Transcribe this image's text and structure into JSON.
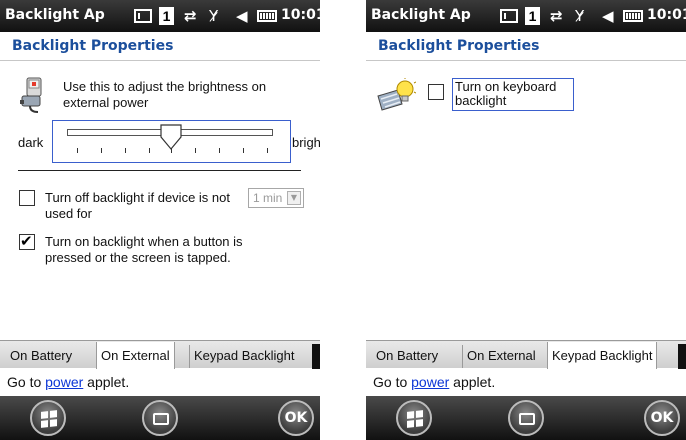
{
  "status_bar": {
    "title": "Backlight Ap",
    "sim_icon": "sim-card-icon",
    "sim_slot": "1",
    "connectivity_icon": "data-connection-icon",
    "signal_icon": "no-signal-icon",
    "volume_icon": "volume-icon",
    "battery_icon": "battery-icon",
    "clock": "10:01"
  },
  "page_title": "Backlight Properties",
  "external_tab_view": {
    "description": "Use this to adjust the brightness on external power",
    "slider": {
      "min_label": "dark",
      "max_label": "bright",
      "level": 0.5
    },
    "option_auto_off": {
      "label": "Turn off backlight if device is not used for",
      "checked": false,
      "timeout_value": "1 min"
    },
    "option_tap_on": {
      "label": "Turn on backlight when a button is pressed or the screen is tapped.",
      "checked": true
    }
  },
  "keypad_tab_view": {
    "checkbox_label": "Turn on keyboard backlight",
    "checked": false
  },
  "tabs": [
    {
      "label": "On Battery"
    },
    {
      "label": "On External"
    },
    {
      "label": "Keypad Backlight"
    }
  ],
  "footer": {
    "prefix": "Go to ",
    "link": "power",
    "suffix": " applet."
  },
  "softkeys": {
    "start_icon": "windows-start-icon",
    "keyboard_icon": "keyboard-icon",
    "ok_label": "OK"
  }
}
